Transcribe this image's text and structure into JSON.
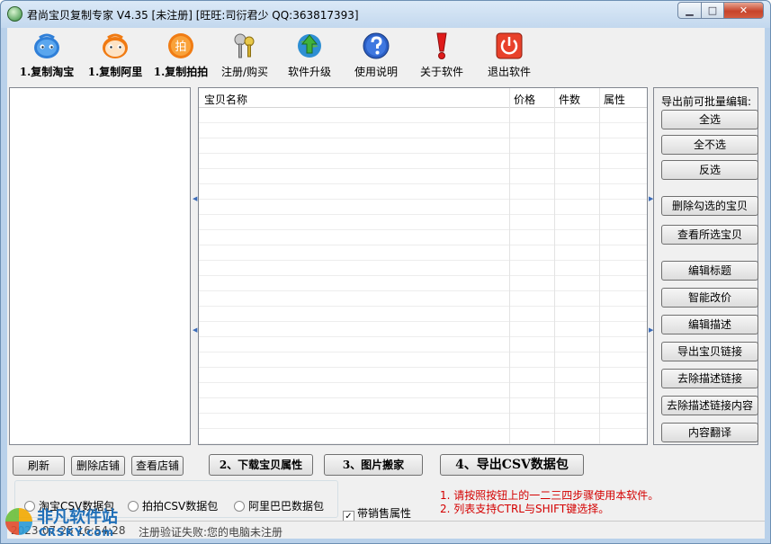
{
  "window": {
    "title": "君尚宝贝复制专家 V4.35 [未注册] [旺旺:司衍君少 QQ:363817393]",
    "minimize_glyph": "▁",
    "maximize_glyph": "□",
    "close_glyph": "✕"
  },
  "toolbar": {
    "items": [
      {
        "label": "1.复制淘宝",
        "icon": "taobao-icon"
      },
      {
        "label": "1.复制阿里",
        "icon": "alibaba-icon"
      },
      {
        "label": "1.复制拍拍",
        "icon": "paipai-icon"
      },
      {
        "label": "注册/购买",
        "icon": "keys-icon"
      },
      {
        "label": "软件升级",
        "icon": "upgrade-icon"
      },
      {
        "label": "使用说明",
        "icon": "help-icon"
      },
      {
        "label": "关于软件",
        "icon": "about-icon"
      },
      {
        "label": "退出软件",
        "icon": "exit-icon"
      }
    ],
    "paipai_glyph": "拍"
  },
  "grid": {
    "columns": [
      "宝贝名称",
      "价格",
      "件数",
      "属性"
    ]
  },
  "splitter": {
    "left_arrow": "◀",
    "right_arrow": "▶"
  },
  "right_panel": {
    "title": "导出前可批量编辑:",
    "buttons": [
      "全选",
      "全不选",
      "反选",
      "删除勾选的宝贝",
      "查看所选宝贝",
      "编辑标题",
      "智能改价",
      "编辑描述",
      "导出宝贝链接",
      "去除描述链接",
      "去除描述链接内容",
      "内容翻译"
    ]
  },
  "bottom": {
    "refresh": "刷新",
    "delete_shop": "删除店铺",
    "view_shop": "查看店铺",
    "step2": "2、下载宝贝属性",
    "step3": "3、图片搬家",
    "step4": "4、导出CSV数据包"
  },
  "export_options": {
    "radios": [
      "淘宝CSV数据包",
      "拍拍CSV数据包",
      "阿里巴巴数据包"
    ],
    "checkbox_label": "带销售属性",
    "checkbox_checked": true,
    "check_glyph": "✓"
  },
  "notes": [
    "1. 请按照按钮上的一二三四步骤使用本软件。",
    "2. 列表支持CTRL与SHIFT键选择。"
  ],
  "status": {
    "time": "2023-07-25 16:54:28",
    "message": "注册验证失败:您的电脑未注册"
  },
  "watermark": {
    "name": "非凡软件站",
    "site": "CRSKY.com"
  }
}
